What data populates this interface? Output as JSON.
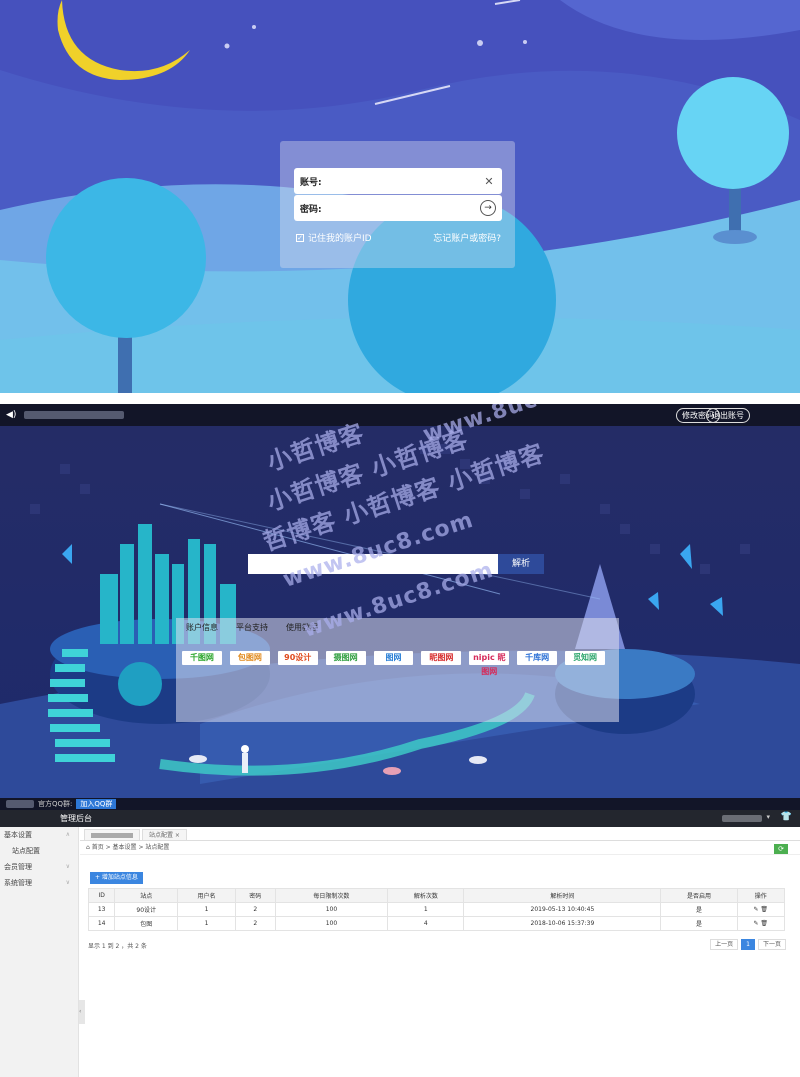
{
  "login": {
    "account_label": "账号:",
    "password_label": "密码:",
    "remember_label": "记住我的账户ID",
    "forgot_label": "忘记账户或密码?"
  },
  "dashboard": {
    "change_password": "修改密码",
    "logout": "退出账号",
    "search_button": "解析",
    "tabs": [
      "账户信息",
      "平台支持",
      "使用教程"
    ],
    "sites": [
      {
        "name": "千图网",
        "color": "#2aa52a"
      },
      {
        "name": "包图网",
        "color": "#e08a1e"
      },
      {
        "name": "90设计",
        "color": "#e04b1e"
      },
      {
        "name": "摄图网",
        "color": "#2e9e3e"
      },
      {
        "name": "图网",
        "color": "#2a7fd6"
      },
      {
        "name": "昵图网",
        "color": "#d62a2a"
      },
      {
        "name": "nipic 昵图网",
        "color": "#d62a5a"
      },
      {
        "name": "千库网",
        "color": "#2a6fd6"
      },
      {
        "name": "觅知网",
        "color": "#2aa56a"
      }
    ],
    "qq_group_label": "官方QQ群:",
    "qq_join_button": "加入QQ群",
    "watermark_lines": [
      "小哲博客",
      "小哲博客 小哲博客",
      "小哲博客 小哲博客 小哲博客",
      "哲博客 小哲博客 小哲博客",
      "www.8uc8.com",
      "www.8uc8.com",
      "www.8uc8.com"
    ]
  },
  "admin": {
    "title": "管理后台",
    "sidebar": [
      {
        "label": "基本设置",
        "caret": "∧"
      },
      {
        "label": "站点配置",
        "sub": true
      },
      {
        "label": "会员管理",
        "caret": "∨"
      },
      {
        "label": "系统管理",
        "caret": "∨"
      }
    ],
    "tabs": [
      "站点配置"
    ],
    "breadcrumb": "⌂ 首页  >  基本设置  >  站点配置",
    "refresh_icon": "⟳",
    "add_button": "+ 增加站点信息",
    "columns": [
      "ID",
      "站点",
      "用户名",
      "密码",
      "每日限制次数",
      "解析次数",
      "解析时间",
      "是否启用",
      "操作"
    ],
    "rows": [
      [
        "13",
        "90设计",
        "1",
        "2",
        "100",
        "1",
        "2019-05-13 10:40:45",
        "是",
        "✎ 🗑"
      ],
      [
        "14",
        "包图",
        "1",
        "2",
        "100",
        "4",
        "2018-10-06 15:37:39",
        "是",
        "✎ 🗑"
      ]
    ],
    "pager_info": "显示 1 到 2 ，共 2 条",
    "pager": {
      "prev": "上一页",
      "current": "1",
      "next": "下一页"
    }
  }
}
